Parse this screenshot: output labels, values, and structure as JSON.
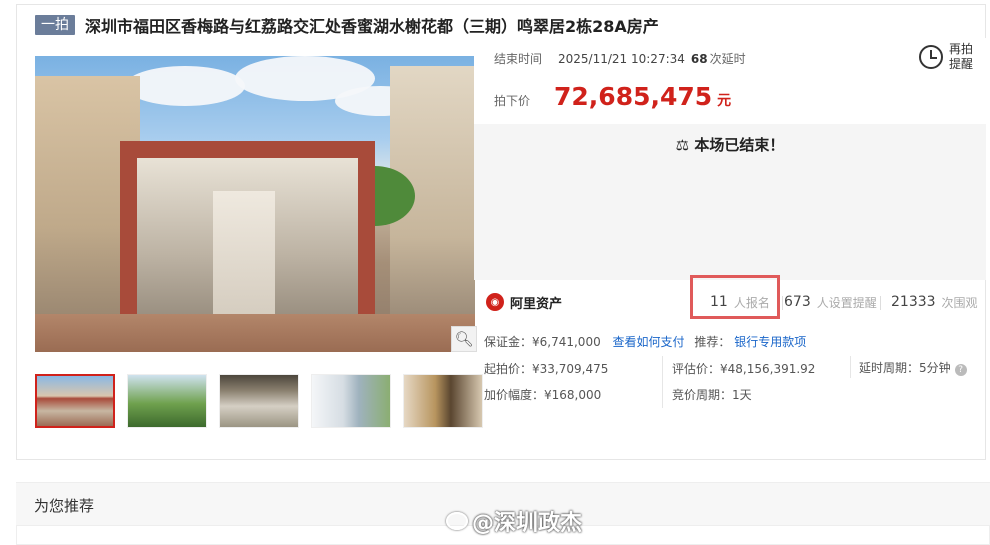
{
  "header": {
    "badge": "一拍",
    "title": "深圳市福田区香梅路与红荔路交汇处香蜜湖水榭花都（三期）鸣翠居2栋28A房产"
  },
  "auction": {
    "end_label": "结束时间",
    "end_time": "2025/11/21 10:27:34",
    "delay_count": "68",
    "delay_label": "次延时",
    "remind_line1": "再拍",
    "remind_line2": "提醒",
    "price_label": "拍下价",
    "price": "72,685,475",
    "currency": "元",
    "ended_text": "本场已结束！"
  },
  "stats": {
    "brand": "阿里资产",
    "signups": "11",
    "signups_label": "人报名",
    "reminders": "673",
    "reminders_label": "人设置提醒",
    "views": "21333",
    "views_label": "次围观"
  },
  "details": {
    "deposit": "保证金：¥6,741,000",
    "deposit_link": "查看如何支付",
    "recommend_label": "推荐：",
    "recommend_link": "银行专用款项",
    "start_price": "起拍价：¥33,709,475",
    "appraisal": "评估价：¥48,156,391.92",
    "delay_period": "延时周期：5分钟",
    "increment": "加价幅度：¥168,000",
    "bid_period": "竞价周期：1天"
  },
  "recommend": {
    "title": "为您推荐"
  },
  "watermark": "@深圳政杰",
  "icons": {
    "zoom": "magnifier-icon",
    "remind": "alarm-clock-icon",
    "gavel": "gavel-icon",
    "help": "question-icon"
  },
  "colors": {
    "accent": "#d0221b",
    "badge": "#6b7d9a",
    "link": "#1a66c9",
    "highlight": "#e05a5a"
  }
}
